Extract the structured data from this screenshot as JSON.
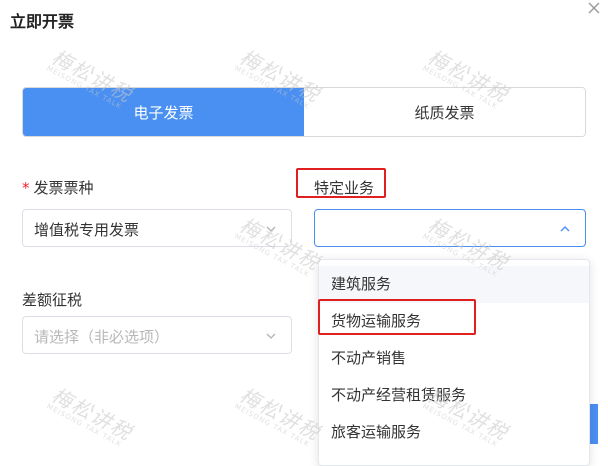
{
  "dialog": {
    "title": "立即开票"
  },
  "invoice_type_tabs": [
    {
      "label": "电子发票",
      "active": true
    },
    {
      "label": "纸质发票",
      "active": false
    }
  ],
  "fields": {
    "invoice_kind": {
      "required_mark": "*",
      "label": "发票票种",
      "value": "增值税专用发票"
    },
    "special_business": {
      "label": "特定业务",
      "value": ""
    },
    "difference_tax": {
      "label": "差额征税",
      "placeholder": "请选择（非必选项）"
    }
  },
  "dropdown": {
    "options": [
      {
        "label": "建筑服务",
        "hovered": true
      },
      {
        "label": "货物运输服务",
        "highlighted": true
      },
      {
        "label": "不动产销售"
      },
      {
        "label": "不动产经营租赁服务"
      },
      {
        "label": "旅客运输服务"
      }
    ]
  },
  "watermark": {
    "text": "梅松讲税",
    "subtext": "MEISONG TAX TALK"
  },
  "colors": {
    "accent": "#4a90f2",
    "highlight_border": "#e02020",
    "required": "#f5222d"
  }
}
